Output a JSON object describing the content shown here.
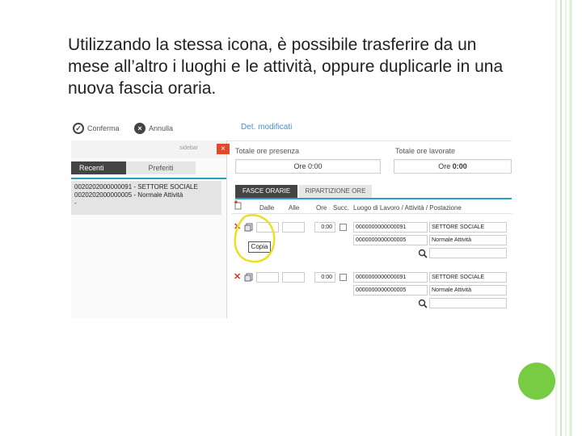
{
  "slide": {
    "text": "Utilizzando la stessa icona, è possibile trasferire da un mese all’altro i luoghi e le attività, oppure duplicarle in una nuova fascia oraria."
  },
  "toolbar": {
    "confirm_label": "Conferma",
    "cancel_label": "Annulla",
    "details_label": "Det. modificati"
  },
  "sidebar": {
    "title": "sidebar",
    "close_label": "×",
    "tabs": [
      "Recenti",
      "Preferiti"
    ],
    "recent_items": [
      "0020202000000091 - SETTORE SOCIALE",
      "0020202000000005 - Normale Attività",
      "-"
    ]
  },
  "totals": {
    "presence_label": "Totale ore presenza",
    "worked_label": "Totale ore lavorate",
    "presence_prefix": "Ore",
    "presence_value": "0:00",
    "worked_prefix": "Ore",
    "worked_value": "0:00"
  },
  "sections": {
    "tabs": [
      "FASCE ORARIE",
      "RIPARTIZIONE ORE"
    ]
  },
  "table": {
    "columns": [
      "Dalle",
      "Alle",
      "Ore",
      "Succ.",
      "Luogo di Lavoro / Attività / Postazione"
    ],
    "tooltip": "Copia",
    "rows": [
      {
        "ore": "0:00",
        "place_code": "0000000000000091",
        "place_name": "SETTORE SOCIALE",
        "activity_code": "0000000000000005",
        "activity_name": "Normale Attività"
      },
      {
        "ore": "0:00",
        "place_code": "0000000000000091",
        "place_name": "SETTORE SOCIALE",
        "activity_code": "0000000000000005",
        "activity_name": "Normale Attività"
      }
    ]
  },
  "colors": {
    "accent": "#27a3c6",
    "close": "#e04a2a",
    "highlight": "#e8e020",
    "green_dot": "#77cc44"
  }
}
